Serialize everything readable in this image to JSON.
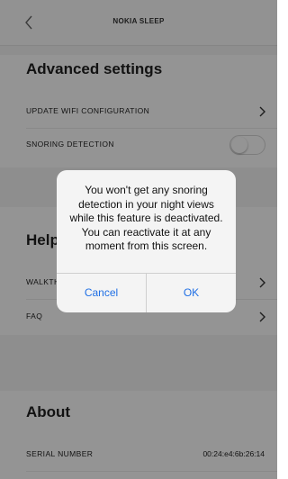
{
  "nav": {
    "title": "NOKIA SLEEP",
    "back_icon": "chevron-left-icon"
  },
  "advanced": {
    "title": "Advanced settings",
    "items": [
      {
        "label": "UPDATE WIFI CONFIGURATION"
      },
      {
        "label": "SNORING DETECTION",
        "toggle_on": false
      }
    ]
  },
  "help": {
    "title": "Help",
    "items": [
      {
        "label": "WALKTHROUGH"
      },
      {
        "label": "FAQ"
      }
    ]
  },
  "about": {
    "title": "About",
    "serial_label": "SERIAL NUMBER",
    "serial_value": "00:24:e4:6b:26:14"
  },
  "dialog": {
    "message": "You won't get any snoring detection in your night views while this feature is deactivated. You can reactivate it at any moment from this screen.",
    "cancel_label": "Cancel",
    "ok_label": "OK"
  },
  "colors": {
    "accent": "#1f6fe5",
    "overlay": "rgba(0,0,0,0.42)"
  }
}
